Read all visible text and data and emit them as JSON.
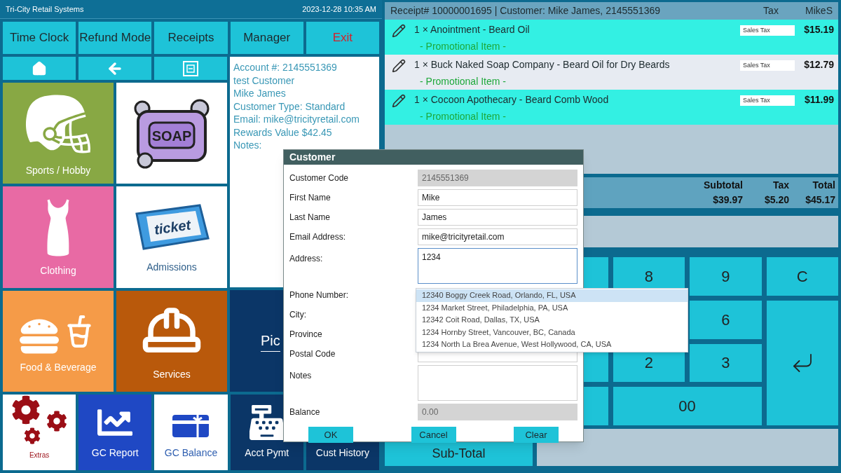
{
  "title_bar": {
    "title": "Tri-City Retail Systems",
    "datetime": "2023-12-28 10:35 AM"
  },
  "top_buttons": [
    {
      "label": "Time Clock",
      "kind": "normal"
    },
    {
      "label": "Refund Mode",
      "kind": "normal"
    },
    {
      "label": "Receipts",
      "kind": "normal"
    },
    {
      "label": "Manager",
      "kind": "normal"
    },
    {
      "label": "Exit",
      "kind": "danger"
    }
  ],
  "nav_buttons": [
    {
      "kind": "home"
    },
    {
      "kind": "back"
    },
    {
      "kind": "minimize"
    }
  ],
  "tiles": [
    {
      "label": "Sports / Hobby",
      "kind": "helmet",
      "color": "#88a844"
    },
    {
      "kind": "soap",
      "icon_text": "SOAP",
      "color": "#ffffff"
    },
    {
      "label": "Clothing",
      "kind": "dress",
      "color": "#e86aa4"
    },
    {
      "label": "Admissions",
      "kind": "ticket",
      "icon_text": "ticket",
      "color": "#ffffff"
    },
    {
      "label": "Food & Beverage",
      "kind": "food",
      "color": "#f59b48"
    },
    {
      "label": "Services",
      "kind": "worker",
      "color": "#b9590b"
    }
  ],
  "customer_info": [
    "Account #: 2145551369",
    "test Customer",
    "Mike James",
    "Customer Type: Standard",
    "Email: mike@tricityretail.com",
    "Rewards Value $42.45",
    "Notes:"
  ],
  "pick_tile": {
    "label": "Pic"
  },
  "bottom_tiles": [
    {
      "label": "Extras",
      "kind": "gears",
      "color": "#ffffff"
    },
    {
      "label": "GC Report",
      "kind": "chart",
      "color": "#1f48c4"
    },
    {
      "label": "GC Balance",
      "kind": "giftcard",
      "color": "#ffffff"
    },
    {
      "label": "Acct Pymt",
      "kind": "payment",
      "color": "#0b3667"
    },
    {
      "label": "Cust History",
      "kind": "none",
      "color": "#0b3667"
    }
  ],
  "receipt": {
    "header": "Receipt# 10000001695 | Customer: Mike James, 2145551369",
    "tax_label": "Tax",
    "user": "MikeS",
    "items": [
      {
        "qty": "1 ×",
        "name": "Anointment - Beard Oil",
        "note": "- Promotional Item -",
        "tax": "Sales Tax",
        "price": "$15.19",
        "highlighted": true
      },
      {
        "qty": "1 ×",
        "name": "Buck Naked Soap Company - Beard Oil for Dry Beards",
        "note": "- Promotional Item -",
        "tax": "Sales Tax",
        "price": "$12.79",
        "highlighted": false
      },
      {
        "qty": "1 ×",
        "name": "Cocoon Apothecary - Beard Comb Wood",
        "note": "- Promotional Item -",
        "tax": "Sales Tax",
        "price": "$11.99",
        "highlighted": true
      }
    ],
    "totals": [
      {
        "label": "Subtotal",
        "value": "$39.97"
      },
      {
        "label": "Tax",
        "value": "$5.20"
      },
      {
        "label": "Total",
        "value": "$45.17"
      }
    ]
  },
  "keypad": [
    {
      "kind": "key"
    },
    {
      "kind": "key",
      "label": "8"
    },
    {
      "kind": "key",
      "label": "9"
    },
    {
      "kind": "key",
      "label": "C"
    },
    {
      "kind": "covered"
    },
    {
      "kind": "covered"
    },
    {
      "kind": "key",
      "label": "6"
    },
    {
      "kind": "enter"
    },
    {
      "kind": "key"
    },
    {
      "kind": "key",
      "label": "2"
    },
    {
      "kind": "key",
      "label": "3"
    },
    {
      "kind": "key"
    },
    {
      "kind": "wide",
      "label": "00"
    }
  ],
  "subtotal_button": {
    "label": "Sub-Total"
  },
  "dialog": {
    "title": "Customer",
    "fields": [
      {
        "label": "Customer Code",
        "value": "2145551369",
        "disabled": true,
        "kind": "line"
      },
      {
        "label": "First Name",
        "value": "Mike",
        "disabled": false,
        "kind": "line"
      },
      {
        "label": "Last Name",
        "value": "James",
        "disabled": false,
        "kind": "line"
      },
      {
        "label": "Email Address:",
        "value": "mike@tricityretail.com",
        "disabled": false,
        "kind": "line"
      },
      {
        "label": "Address:",
        "value": "1234",
        "disabled": false,
        "kind": "multi",
        "focused": true
      },
      {
        "label": "Phone Number:",
        "kind": "covered"
      },
      {
        "label": "City:",
        "kind": "covered"
      },
      {
        "label": "Province",
        "kind": "covered"
      },
      {
        "label": "Postal Code",
        "kind": "line"
      },
      {
        "label": "Notes",
        "disabled": false,
        "kind": "multi"
      },
      {
        "label": "Balance",
        "value": "0.00",
        "disabled": true,
        "kind": "line"
      }
    ],
    "buttons": [
      "OK",
      "Cancel",
      "Clear"
    ],
    "suggestions": [
      {
        "text": "12340 Boggy Creek Road, Orlando, FL, USA",
        "selected": true
      },
      {
        "text": "1234 Market Street, Philadelphia, PA, USA",
        "selected": false
      },
      {
        "text": "12342 Coit Road, Dallas, TX, USA",
        "selected": false
      },
      {
        "text": "1234 Hornby Street, Vancouver, BC, Canada",
        "selected": false
      },
      {
        "text": "1234 North La Brea Avenue, West Hollywood, CA, USA",
        "selected": false
      }
    ]
  }
}
